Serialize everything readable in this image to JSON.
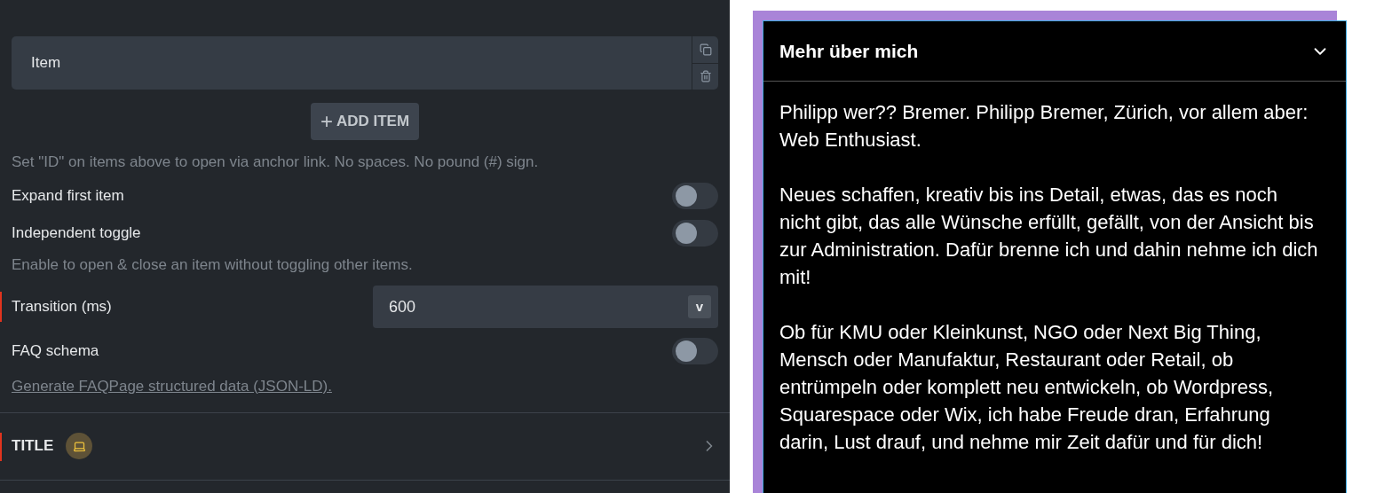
{
  "items": [
    {
      "label": "Item"
    }
  ],
  "add_button": {
    "icon": "+",
    "label": "ADD ITEM"
  },
  "add_hint": "Set \"ID\" on items above to open via anchor link. No spaces. No pound (#) sign.",
  "settings": [
    {
      "kind": "toggle",
      "label": "Expand first item",
      "on": false
    },
    {
      "kind": "toggle",
      "label": "Independent toggle",
      "on": false,
      "hint": "Enable to open & close an item without toggling other items."
    },
    {
      "kind": "number",
      "label": "Transition (ms)",
      "value": "600",
      "unit": "v"
    },
    {
      "kind": "toggle",
      "label": "FAQ schema",
      "on": false,
      "link": "Generate FAQPage structured data (JSON-LD)."
    }
  ],
  "section": {
    "title": "TITLE",
    "expanded": false
  },
  "preview": {
    "title": "Mehr über mich",
    "expanded": true,
    "paragraphs": [
      "Philipp wer?? Bremer. Philipp Bremer, Zürich, vor allem aber: Web Enthusiast.",
      "Neues schaffen, kreativ bis ins Detail, etwas, das es noch nicht gibt, das alle Wünsche erfüllt, gefällt, von der Ansicht bis zur Administration. Dafür brenne ich und dahin nehme ich dich mit!",
      "Ob für KMU oder Kleinkunst, NGO oder Next Big Thing, Mensch oder Manufaktur, Restaurant oder Retail, ob entrümpeln oder komplett neu entwickeln, ob Wordpress, Squarespace oder Wix, ich habe Freude dran, Erfahrung darin, Lust drauf, und nehme mir Zeit dafür und für dich!"
    ]
  }
}
